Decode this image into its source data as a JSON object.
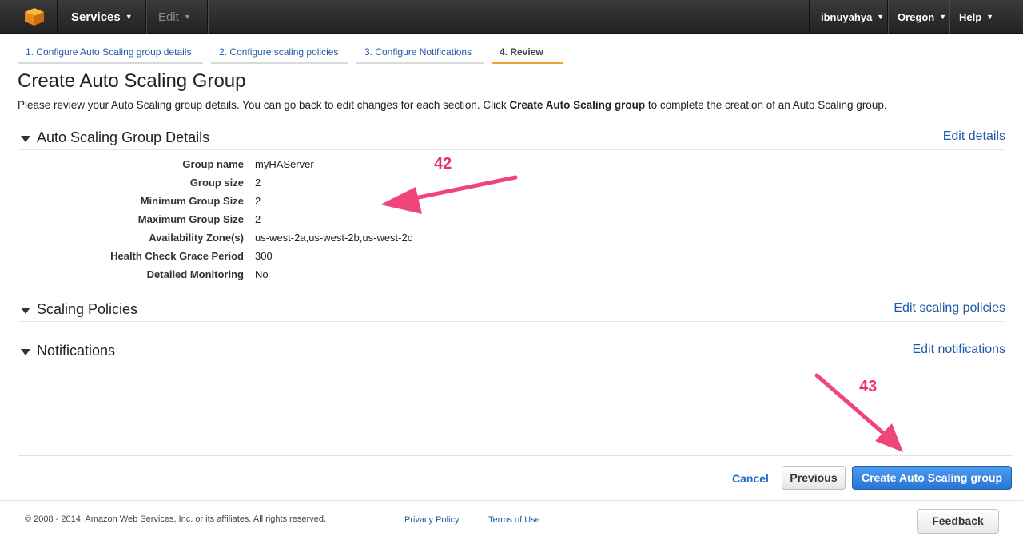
{
  "topnav": {
    "logo_icon": "aws-cube-icon",
    "services": "Services",
    "edit": "Edit",
    "user": "ibnuyahya",
    "region": "Oregon",
    "help": "Help"
  },
  "wizard": {
    "tabs": [
      {
        "label": "1. Configure Auto Scaling group details"
      },
      {
        "label": "2. Configure scaling policies"
      },
      {
        "label": "3. Configure Notifications"
      },
      {
        "label": "4. Review"
      }
    ],
    "active_tab": "4. Review"
  },
  "page": {
    "title": "Create Auto Scaling Group",
    "intro_before": "Please review your Auto Scaling group details. You can go back to edit changes for each section. Click ",
    "intro_bold": "Create Auto Scaling group",
    "intro_after": " to complete the creation of an Auto Scaling group."
  },
  "sections": {
    "details": {
      "title": "Auto Scaling Group Details",
      "edit_link": "Edit details",
      "rows": [
        {
          "key": "Group name",
          "value": "myHAServer"
        },
        {
          "key": "Group size",
          "value": "2"
        },
        {
          "key": "Minimum Group Size",
          "value": "2"
        },
        {
          "key": "Maximum Group Size",
          "value": "2"
        },
        {
          "key": "Availability Zone(s)",
          "value": "us-west-2a,us-west-2b,us-west-2c"
        },
        {
          "key": "Health Check Grace Period",
          "value": "300"
        },
        {
          "key": "Detailed Monitoring",
          "value": "No"
        }
      ]
    },
    "policies": {
      "title": "Scaling Policies",
      "edit_link": "Edit scaling policies"
    },
    "notifications": {
      "title": "Notifications",
      "edit_link": "Edit notifications"
    }
  },
  "annotations": {
    "callout_1": "42",
    "callout_2": "43",
    "color": "#e8336a"
  },
  "actions": {
    "cancel": "Cancel",
    "previous": "Previous",
    "create": "Create Auto Scaling group"
  },
  "footer": {
    "copyright": "© 2008 - 2014, Amazon Web Services, Inc. or its affiliates. All rights reserved.",
    "privacy": "Privacy Policy",
    "terms": "Terms of Use",
    "feedback": "Feedback"
  },
  "colors": {
    "link": "#1f5aa6",
    "primary_button": "#2a75d3",
    "active_tab_underline": "#f0a030",
    "topnav": "#2b2b2b"
  }
}
